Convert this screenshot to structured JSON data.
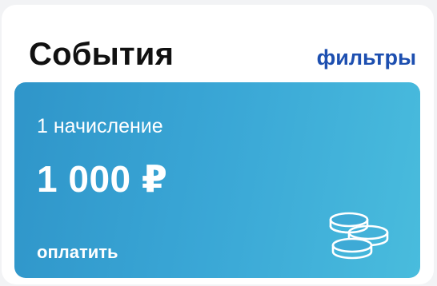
{
  "header": {
    "title": "События",
    "filters_label": "фильтры"
  },
  "card": {
    "count_label": "1 начисление",
    "amount": "1 000 ₽",
    "pay_label": "оплатить",
    "icon": "coins-icon"
  },
  "colors": {
    "card_gradient_start": "#2f95c9",
    "card_gradient_end": "#49bcdd",
    "link": "#1d4fb0",
    "title": "#111111"
  }
}
